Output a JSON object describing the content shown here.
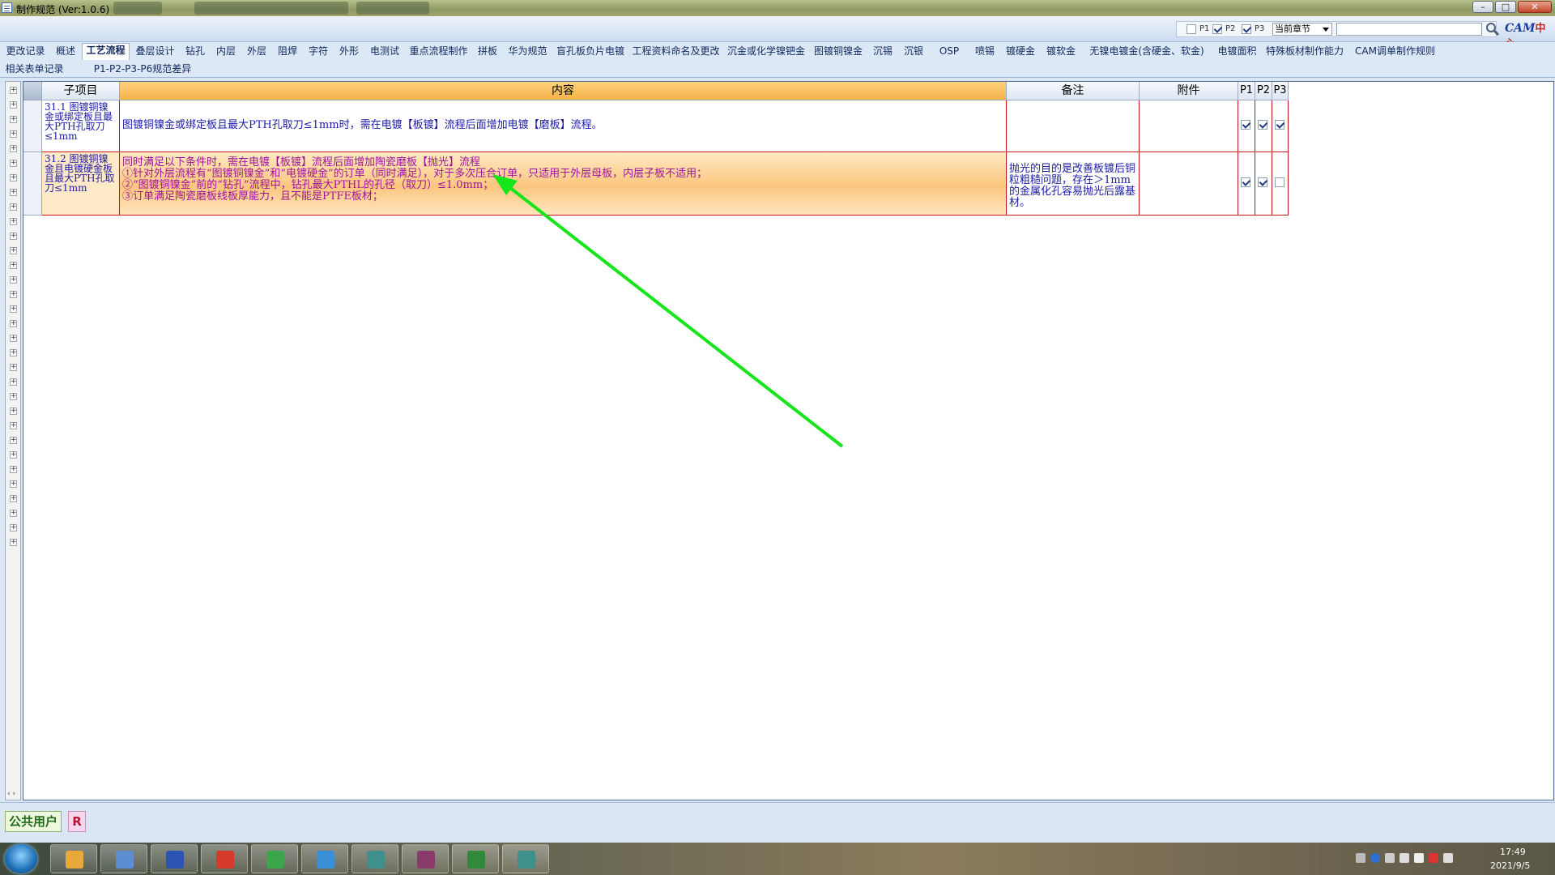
{
  "window": {
    "title": "制作规范 (Ver:1.0.6)",
    "controls": {
      "minimize": "–",
      "maximize": "□",
      "close": "✕"
    }
  },
  "toolbar": {
    "filters": [
      {
        "label": "P1",
        "checked": false
      },
      {
        "label": "P2",
        "checked": true
      },
      {
        "label": "P3",
        "checked": true
      }
    ],
    "scope_select": "当前章节",
    "search": {
      "value": "",
      "icon": "search-icon"
    },
    "logo": {
      "latin": "CAM",
      "zh": "中心"
    }
  },
  "tabs_row1": [
    "更改记录",
    "概述",
    "工艺流程",
    "叠层设计",
    "钻孔",
    "内层",
    "外层",
    "阻焊",
    "字符",
    "外形",
    "电测试",
    "重点流程制作",
    "拼板",
    "华为规范",
    "盲孔板负片电镀",
    "工程资料命名及更改",
    "沉金或化学镍钯金",
    "图镀铜镍金",
    "沉锡",
    "沉银",
    "OSP",
    "喷锡",
    "镀硬金",
    "镀软金",
    "无镍电镀金(含硬金、软金)",
    "电镀面积",
    "特殊板材制作能力",
    "CAM调单制作规则"
  ],
  "tabs_row1_selected": 2,
  "tabs_row2": [
    "相关表单记录",
    "P1-P2-P3-P6规范差异"
  ],
  "grid": {
    "headers": {
      "subitem": "子项目",
      "content": "内容",
      "remark": "备注",
      "attachment": "附件",
      "p1": "P1",
      "p2": "P2",
      "p3": "P3"
    },
    "rows": [
      {
        "subitem": "31.1 图镀铜镍金或绑定板且最大PTH孔取刀≤1mm",
        "content": "图镀铜镍金或绑定板且最大PTH孔取刀≤1mm时，需在电镀【板镀】流程后面增加电镀【磨板】流程。",
        "remark": "",
        "attachment": "",
        "p1": true,
        "p2": true,
        "p3": true
      },
      {
        "subitem": "31.2 图镀铜镍金且电镀硬金板且最大PTH孔取刀≤1mm",
        "content_lines": [
          "同时满足以下条件时，需在电镀【板镀】流程后面增加陶瓷磨板【抛光】流程",
          "①针对外层流程有“图镀铜镍金”和“电镀硬金”的订单（同时满足），对于多次压合订单，只适用于外层母板，内层子板不适用；",
          "②“图镀铜镍金”前的“钻孔”流程中，钻孔最大PTHL的孔径（取刀）≤1.0mm；",
          "③订单满足陶瓷磨板线板厚能力，且不能是PTFE板材；"
        ],
        "remark": "抛光的目的是改善板镀后铜粒粗糙问题，存在＞1mm的金属化孔容易抛光后露基材。",
        "attachment": "",
        "p1": true,
        "p2": true,
        "p3": false,
        "selected": true
      }
    ]
  },
  "annotation": {
    "arrow_color": "#16e51a"
  },
  "statusbar": {
    "user": "公共用户",
    "role_badge": "R"
  },
  "taskbar": {
    "apps": [
      "paint-icon",
      "notepad-icon",
      "save-disk-icon",
      "red-g-app-icon",
      "green-p-app-icon",
      "blue-arrow-app-icon",
      "eye-app-icon",
      "x-app-icon",
      "excel-icon",
      "eye-app-icon-2"
    ],
    "clock_time": "17:49",
    "clock_date": "2021/9/5"
  }
}
